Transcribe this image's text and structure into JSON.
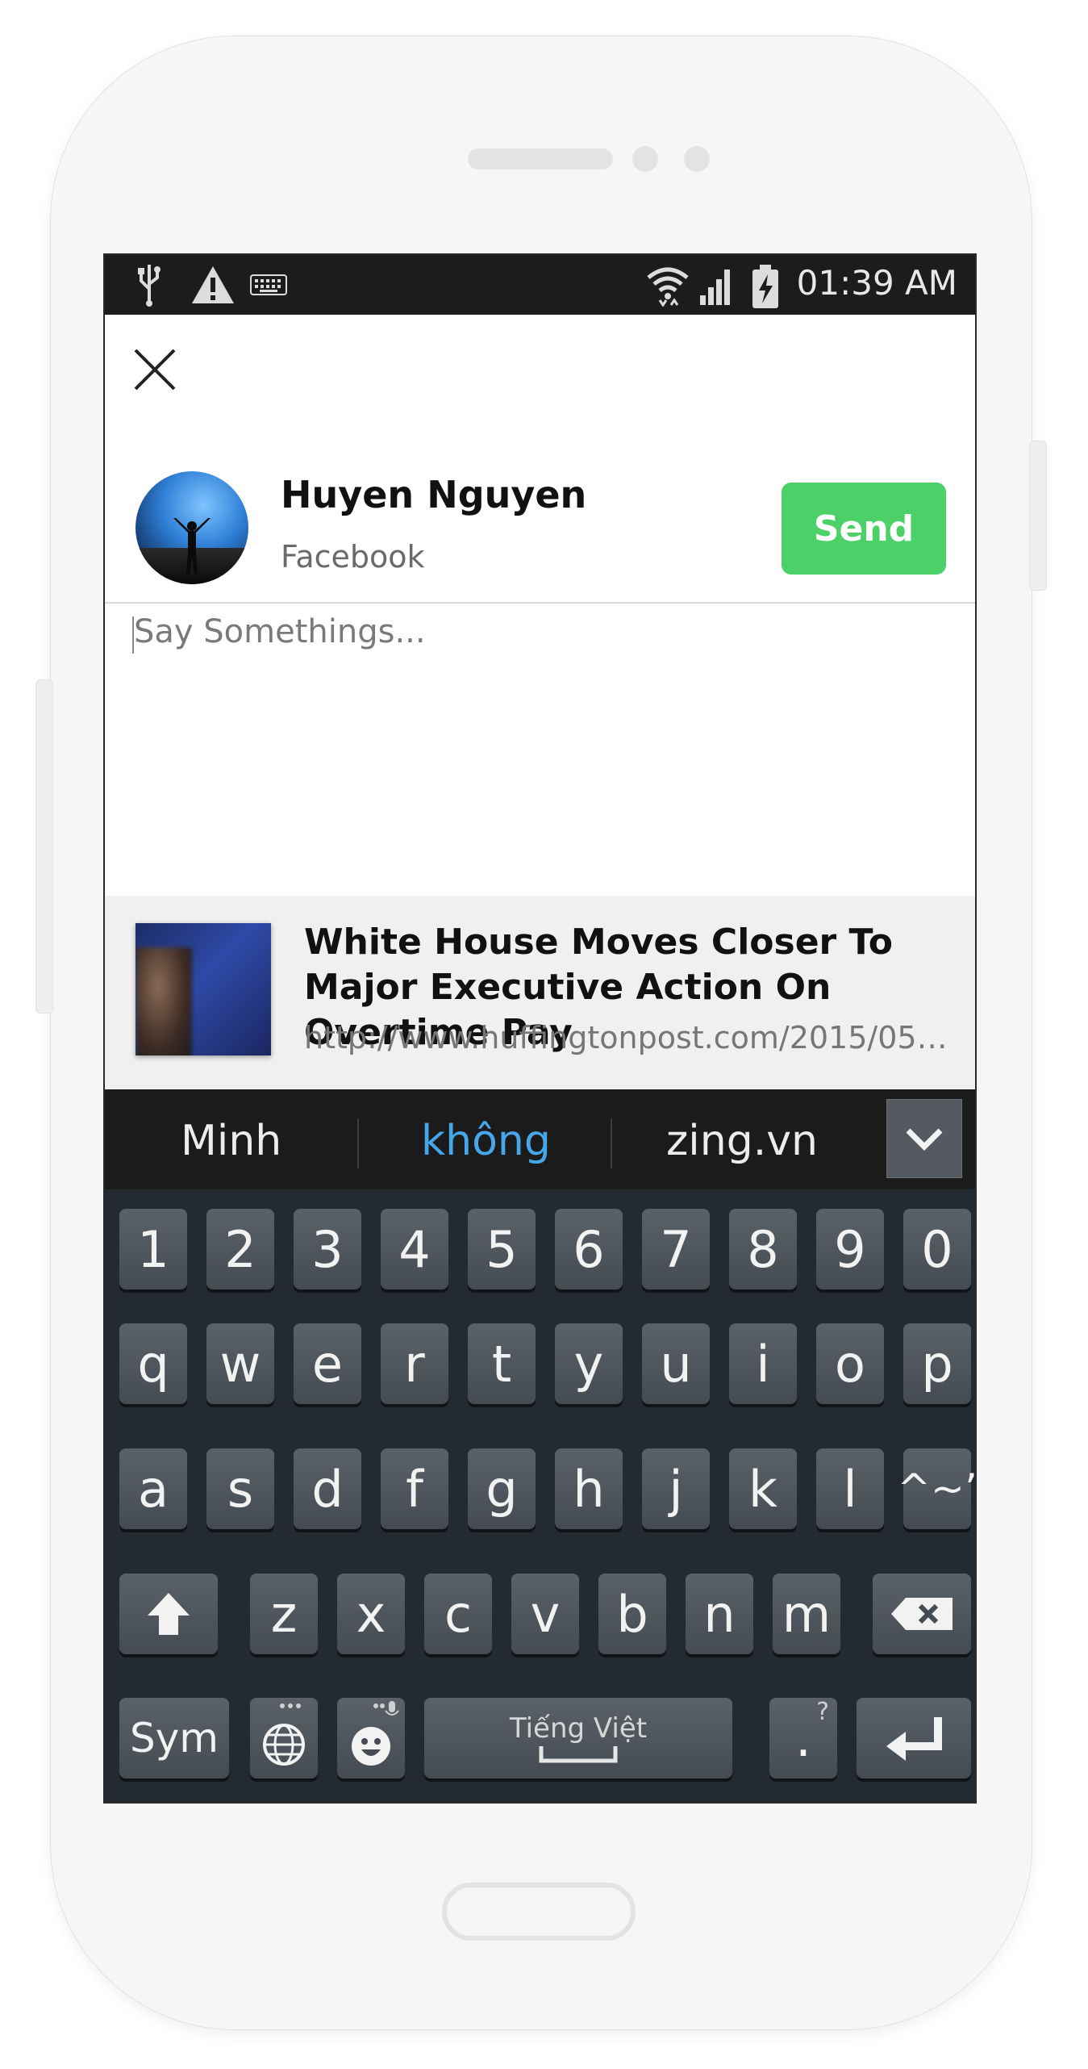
{
  "status_bar": {
    "time": "01:39 AM",
    "left_icons": [
      "usb-icon",
      "warning-icon",
      "keyboard-icon"
    ],
    "right_icons": [
      "wifi-icon",
      "signal-icon",
      "battery-charging-icon"
    ]
  },
  "share": {
    "user_name": "Huyen Nguyen",
    "source": "Facebook",
    "send_label": "Send",
    "compose_placeholder": "Say Somethings...",
    "link": {
      "title": "White House Moves Closer To Major Executive Action On Overtime Pay",
      "url": "http://www.huffingtonpost.com/2015/05/..."
    }
  },
  "keyboard": {
    "suggestions": [
      "Minh",
      "không",
      "zing.vn"
    ],
    "active_suggestion": "không",
    "row_numbers": [
      "1",
      "2",
      "3",
      "4",
      "5",
      "6",
      "7",
      "8",
      "9",
      "0"
    ],
    "row1": [
      "q",
      "w",
      "e",
      "r",
      "t",
      "y",
      "u",
      "i",
      "o",
      "p"
    ],
    "row2": [
      "a",
      "s",
      "d",
      "f",
      "g",
      "h",
      "j",
      "k",
      "l",
      "^~’"
    ],
    "row3": [
      "z",
      "x",
      "c",
      "v",
      "b",
      "n",
      "m"
    ],
    "sym_label": "Sym",
    "space_label": "Tiếng Việt",
    "period_label": ".",
    "period_hint": "?"
  },
  "colors": {
    "send_green": "#4cd068",
    "suggestion_active": "#46a6ea",
    "keyboard_bg": "#242a32"
  }
}
